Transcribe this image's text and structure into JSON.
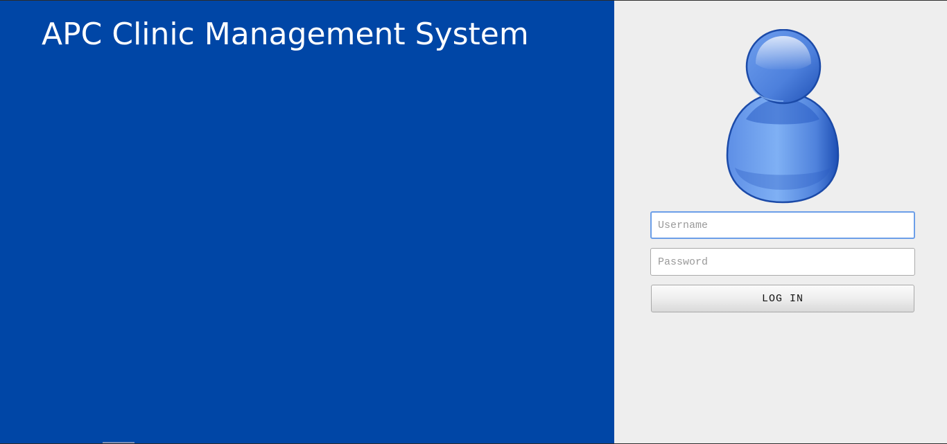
{
  "app": {
    "title": "APC Clinic Management System"
  },
  "login": {
    "avatar_icon": "user-avatar-icon",
    "username_placeholder": "Username",
    "password_placeholder": "Password",
    "login_label": "LOG IN"
  },
  "colors": {
    "left_panel": "#0046a6",
    "right_panel": "#eeeeee",
    "title_text": "#ffffff",
    "focus_border": "#6b9ee8"
  }
}
